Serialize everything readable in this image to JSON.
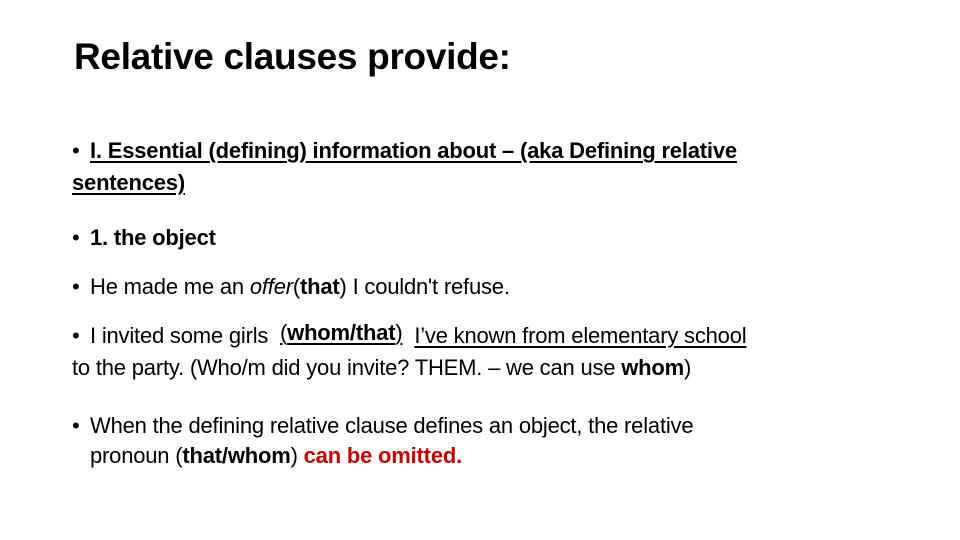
{
  "slide": {
    "title": "Relative clauses provide:",
    "accent_color": "#C00000"
  },
  "bullets": {
    "bullet_glyph": "•",
    "essential": {
      "line1": "I. Essential (defining) information about – (aka Defining relative",
      "line2": "sentences)"
    },
    "object_heading": "1. the object",
    "example1": {
      "before": "He made me an ",
      "italic": "offer",
      "paren_open": "(",
      "bold": "that",
      "paren_close": ")",
      "after": " I couldn't refuse."
    },
    "example2": {
      "before": "I invited some girls ",
      "pronoun_open": "(",
      "pronoun_bold": "whom/that",
      "pronoun_close": ")",
      "underlined_clause": "I’ve known from elementary school",
      "line2_before": "to the party. (Who/m did you invite? THEM. – we can use ",
      "line2_bold": "whom",
      "line2_after": ")"
    },
    "rule": {
      "line1": "When the defining relative clause defines an object, the relative",
      "line2_before": "pronoun (",
      "line2_bold": "that/whom",
      "line2_mid": ") ",
      "line2_red": "can be omitted."
    }
  }
}
